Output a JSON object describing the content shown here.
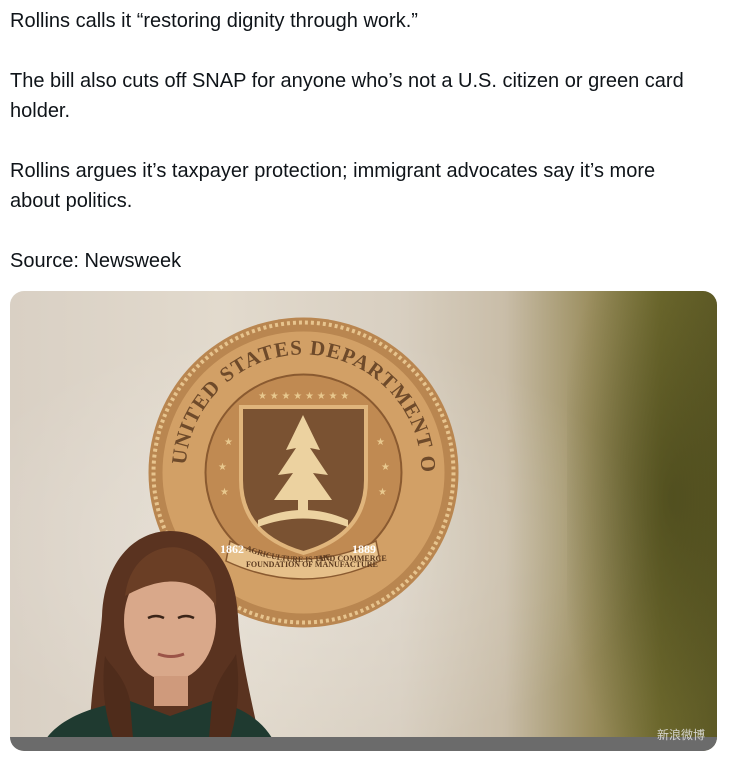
{
  "post": {
    "paragraphs": [
      "Rollins calls it “restoring dignity through work.”",
      "The bill also cuts off SNAP for anyone who’s not a U.S. citizen or green card holder.",
      "Rollins argues it’s taxpayer protection; immigrant advocates say it’s more about politics.",
      "Source: Newsweek"
    ]
  },
  "media": {
    "seal": {
      "ring_text": "UNITED STATES DEPARTMENT OF AGRICULTURE",
      "year_left": "1862",
      "year_right": "1889",
      "ribbon_left": "AGRICULTURE IS THE",
      "ribbon_right": "AND COMMERCE",
      "ribbon_bottom": "FOUNDATION OF MANUFACTURE"
    },
    "watermark": "新浪微博"
  },
  "colors": {
    "text": "#0f1419",
    "wall": "#ddd4c7",
    "seal_wood": "#c9955a",
    "seal_dark": "#6e4a2a",
    "jacket": "#1f3a30",
    "hair": "#5a3320"
  }
}
